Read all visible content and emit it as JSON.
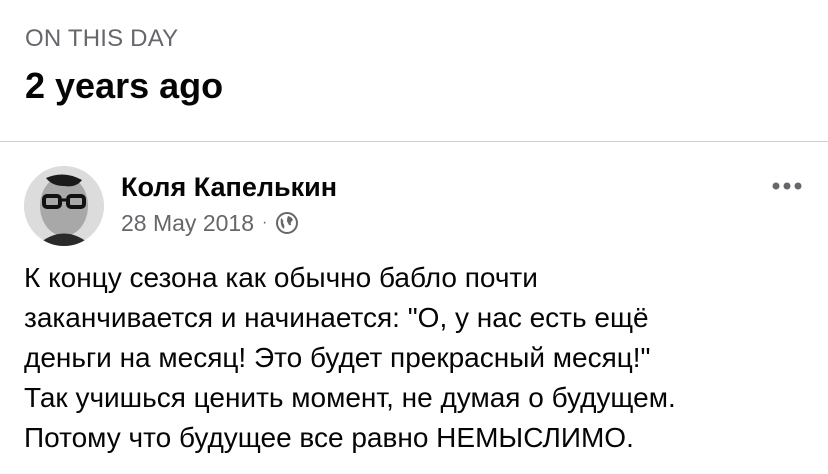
{
  "memories": {
    "label": "ON THIS DAY",
    "title": "2 years ago"
  },
  "post": {
    "author": "Коля Капелькин",
    "date": "28 May 2018",
    "separator": "·",
    "privacy_icon": "globe-icon",
    "more_icon": "more-options-icon",
    "text_lines": [
      "К концу сезона как обычно бабло почти",
      "заканчивается и начинается: \"О, у нас есть ещё",
      "деньги на месяц! Это будет прекрасный месяц!\"",
      "Так учишься ценить момент, не думая о будущем.",
      "Потому что будущее все равно НЕМЫСЛИМО."
    ]
  },
  "colors": {
    "secondary_text": "#65676b",
    "primary_text": "#050505",
    "divider": "#cfd1d5"
  }
}
